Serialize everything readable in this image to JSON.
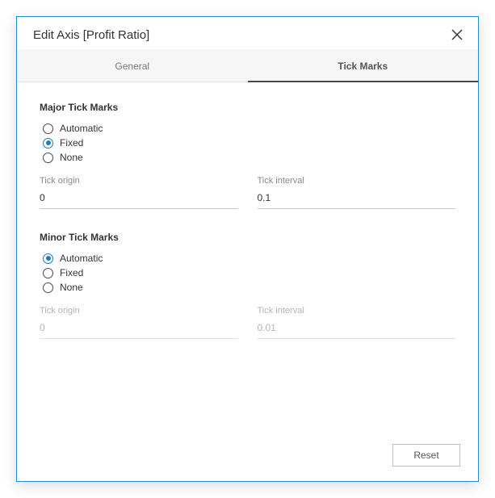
{
  "dialog": {
    "title": "Edit Axis [Profit Ratio]"
  },
  "tabs": {
    "general": "General",
    "tickmarks": "Tick Marks"
  },
  "major": {
    "heading": "Major Tick Marks",
    "options": {
      "automatic": "Automatic",
      "fixed": "Fixed",
      "none": "None"
    },
    "tick_origin_label": "Tick origin",
    "tick_origin_value": "0",
    "tick_interval_label": "Tick interval",
    "tick_interval_value": "0.1"
  },
  "minor": {
    "heading": "Minor Tick Marks",
    "options": {
      "automatic": "Automatic",
      "fixed": "Fixed",
      "none": "None"
    },
    "tick_origin_label": "Tick origin",
    "tick_origin_value": "0",
    "tick_interval_label": "Tick interval",
    "tick_interval_value": "0.01"
  },
  "footer": {
    "reset": "Reset"
  }
}
